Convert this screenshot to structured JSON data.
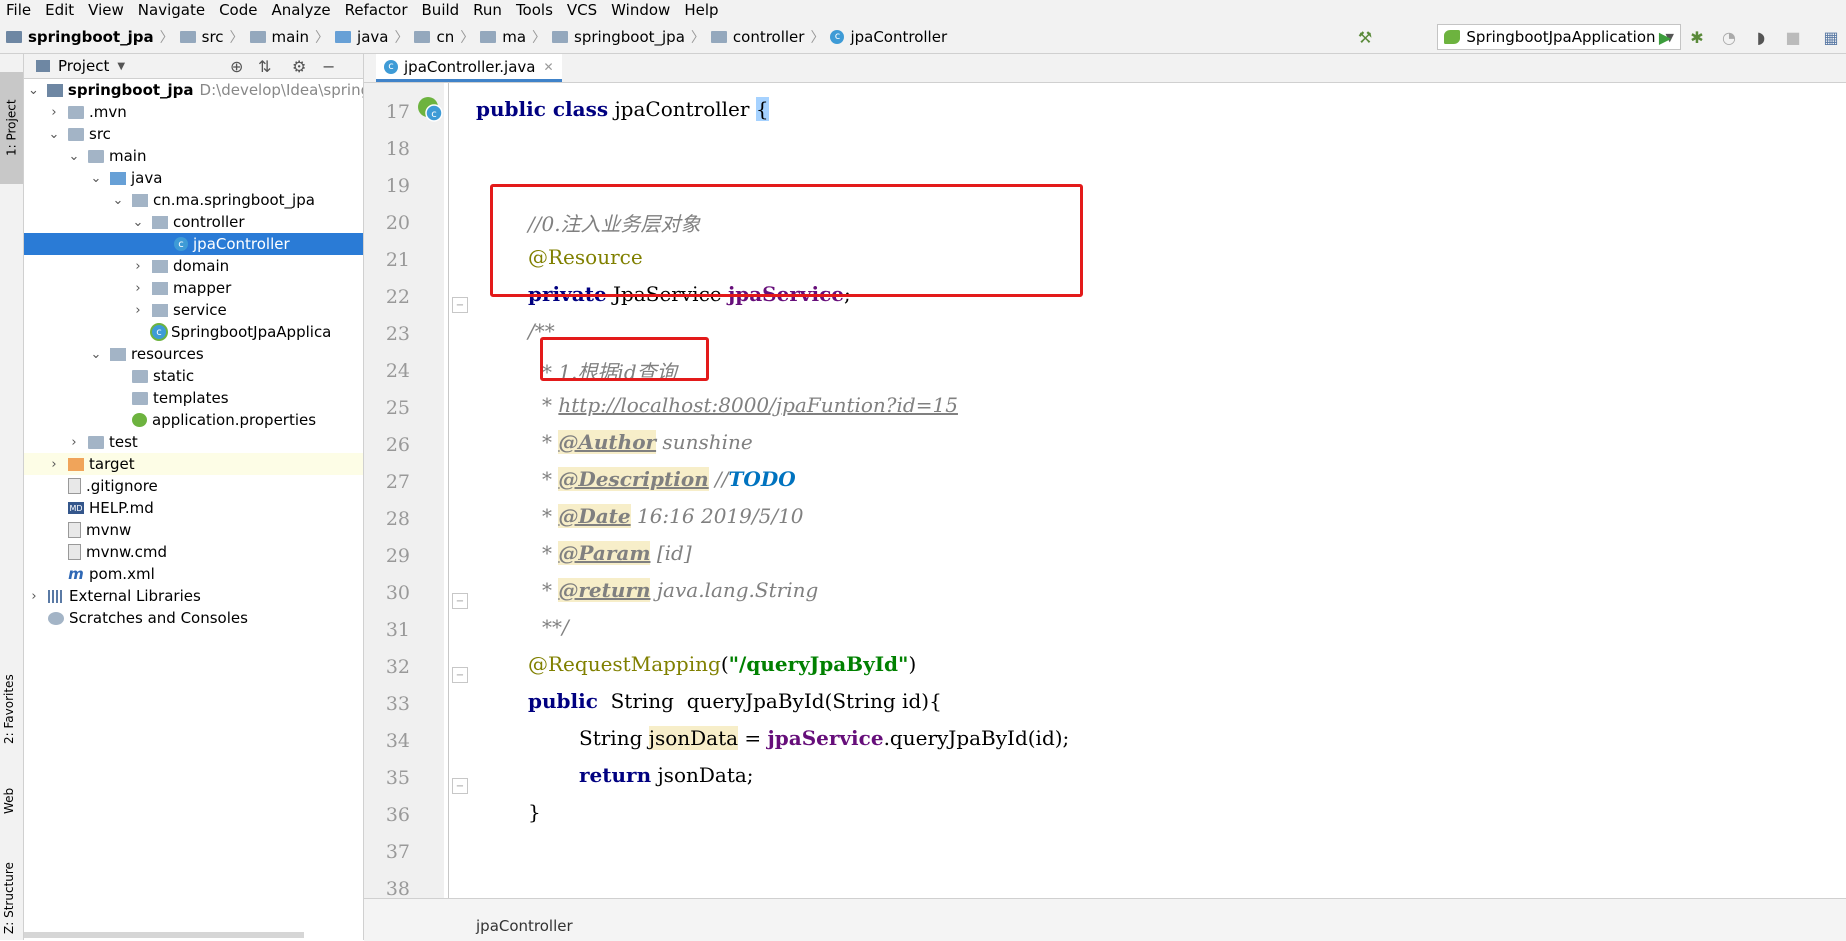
{
  "menu": [
    "File",
    "Edit",
    "View",
    "Navigate",
    "Code",
    "Analyze",
    "Refactor",
    "Build",
    "Run",
    "Tools",
    "VCS",
    "Window",
    "Help"
  ],
  "breadcrumb": [
    "springboot_jpa",
    "src",
    "main",
    "java",
    "cn",
    "ma",
    "springboot_jpa",
    "controller",
    "jpaController"
  ],
  "run_config": "SpringbootJpaApplication",
  "side_tabs": {
    "project": "1: Project",
    "favorites": "2: Favorites",
    "web": "Web",
    "structure": "Z: Structure"
  },
  "project_panel": {
    "title": "Project",
    "root": {
      "name": "springboot_jpa",
      "path": "D:\\develop\\Idea\\spring"
    },
    "items": [
      ".mvn",
      "src",
      "main",
      "java",
      "cn.ma.springboot_jpa",
      "controller",
      "jpaController",
      "domain",
      "mapper",
      "service",
      "SpringbootJpaApplica",
      "resources",
      "static",
      "templates",
      "application.properties",
      "test",
      "target",
      ".gitignore",
      "HELP.md",
      "mvnw",
      "mvnw.cmd",
      "pom.xml",
      "External Libraries",
      "Scratches and Consoles"
    ]
  },
  "editor": {
    "tab": "jpaController.java",
    "line_numbers": [
      "17",
      "18",
      "19",
      "20",
      "21",
      "22",
      "23",
      "24",
      "25",
      "26",
      "27",
      "28",
      "29",
      "30",
      "31",
      "32",
      "33",
      "34",
      "35",
      "36",
      "37",
      "38"
    ],
    "code": {
      "l17_kw": "public class",
      "l17_name": " jpaController ",
      "l17_brace": "{",
      "l19": "//0.注入业务层对象",
      "l20": "@Resource",
      "l21_kw": "private",
      "l21_type": " JpaService ",
      "l21_field": "jpaService",
      "l21_end": ";",
      "l22": "/**",
      "l23": "* 1.根据id查询",
      "l24_star": "* ",
      "l24_link": "http://localhost:8000/jpaFuntion?id=15",
      "l25_star": "* ",
      "l25_tag": "@Author",
      "l25_text": " sunshine",
      "l26_star": "* ",
      "l26_tag": "@Description",
      "l26_text": " //",
      "l26_todo": "TODO",
      "l27_star": "* ",
      "l27_tag": "@Date",
      "l27_text": " 16:16 2019/5/10",
      "l28_star": "* ",
      "l28_tag": "@Param",
      "l28_text": " [id]",
      "l29_star": "* ",
      "l29_tag": "@return",
      "l29_text": " java.lang.String",
      "l30": "**/",
      "l31_ann": "@RequestMapping",
      "l31_open": "(",
      "l31_str": "\"/queryJpaById\"",
      "l31_close": ")",
      "l32_kw": "public",
      "l32_rest": "  String  queryJpaById(String id){",
      "l33_a": "String ",
      "l33_var": "jsonData",
      "l33_b": " = ",
      "l33_field": "jpaService",
      "l33_c": ".queryJpaById(id);",
      "l34_kw": "return",
      "l34_rest": " jsonData;",
      "l35": "}",
      "l37": "}"
    }
  },
  "status_breadcrumb": "jpaController",
  "colors": {
    "keyword": "#000080",
    "annotation": "#808000",
    "comment": "#808080",
    "field": "#660e7a",
    "string": "#008000",
    "selection": "#2a7bd6",
    "highlight_box": "#e31a1a"
  }
}
